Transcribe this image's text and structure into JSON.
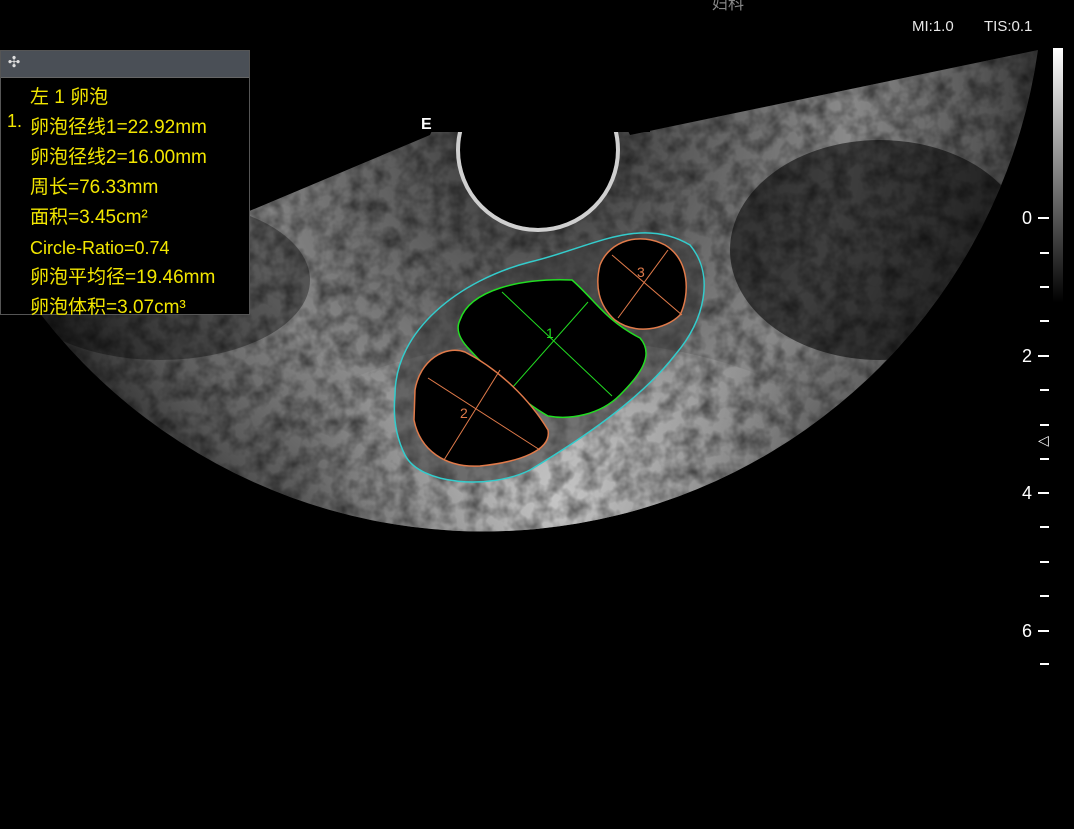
{
  "header": {
    "title": "妇科",
    "mi": "MI:1.0",
    "tis": "TIS:0.1"
  },
  "probe_marker": "E",
  "measurement_panel": {
    "move_icon": "move-icon",
    "index": "1.",
    "lines": [
      "左 1 卵泡",
      "卵泡径线1=22.92mm",
      "卵泡径线2=16.00mm",
      "周长=76.33mm",
      "面积=3.45cm²",
      "Circle-Ratio=0.74",
      "卵泡平均径=19.46mm",
      "卵泡体积=3.07cm³"
    ]
  },
  "follicles": [
    {
      "label": "1",
      "color": "#22dd22"
    },
    {
      "label": "2",
      "color": "#e07a4a"
    },
    {
      "label": "3",
      "color": "#e07a4a"
    }
  ],
  "outline_color": "#33cccc",
  "depth_scale": {
    "labels": [
      "0",
      "2",
      "4",
      "6"
    ]
  }
}
